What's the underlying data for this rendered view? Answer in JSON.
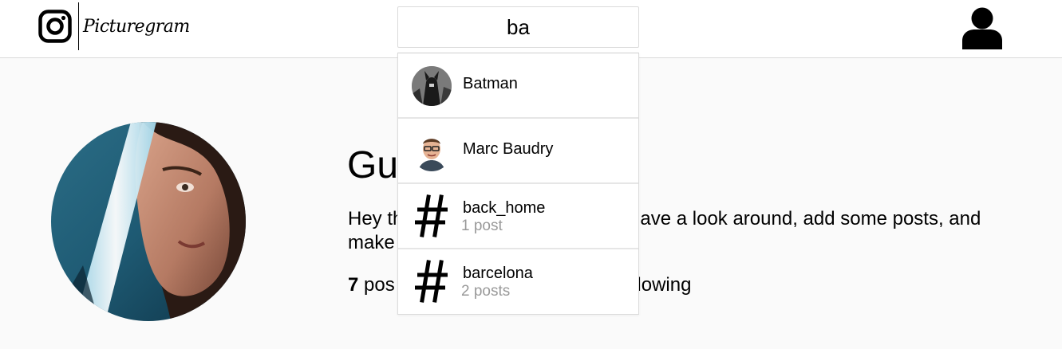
{
  "header": {
    "logo_text": "Picturegram",
    "search_value": "ba"
  },
  "profile": {
    "name_visible": "Gu",
    "bio_line1_start": "Hey th",
    "bio_line1_end": "am. Have a look around, add some posts, and",
    "bio_line2_start": "make",
    "stats_posts_count": "7",
    "stats_posts_label": " pos",
    "stats_following_label": "ollowing"
  },
  "search_results": [
    {
      "type": "user",
      "label": "Batman",
      "sub": ""
    },
    {
      "type": "user",
      "label": "Marc Baudry",
      "sub": ""
    },
    {
      "type": "hashtag",
      "label": "back_home",
      "sub": "1 post"
    },
    {
      "type": "hashtag",
      "label": "barcelona",
      "sub": "2 posts"
    }
  ],
  "icons": {
    "logo": "instagram-camera-icon",
    "user": "user-account-icon",
    "hashtag": "hashtag-icon"
  },
  "colors": {
    "border": "#dbdbdb",
    "page_background": "#fafafa",
    "secondary_text": "#999999"
  }
}
